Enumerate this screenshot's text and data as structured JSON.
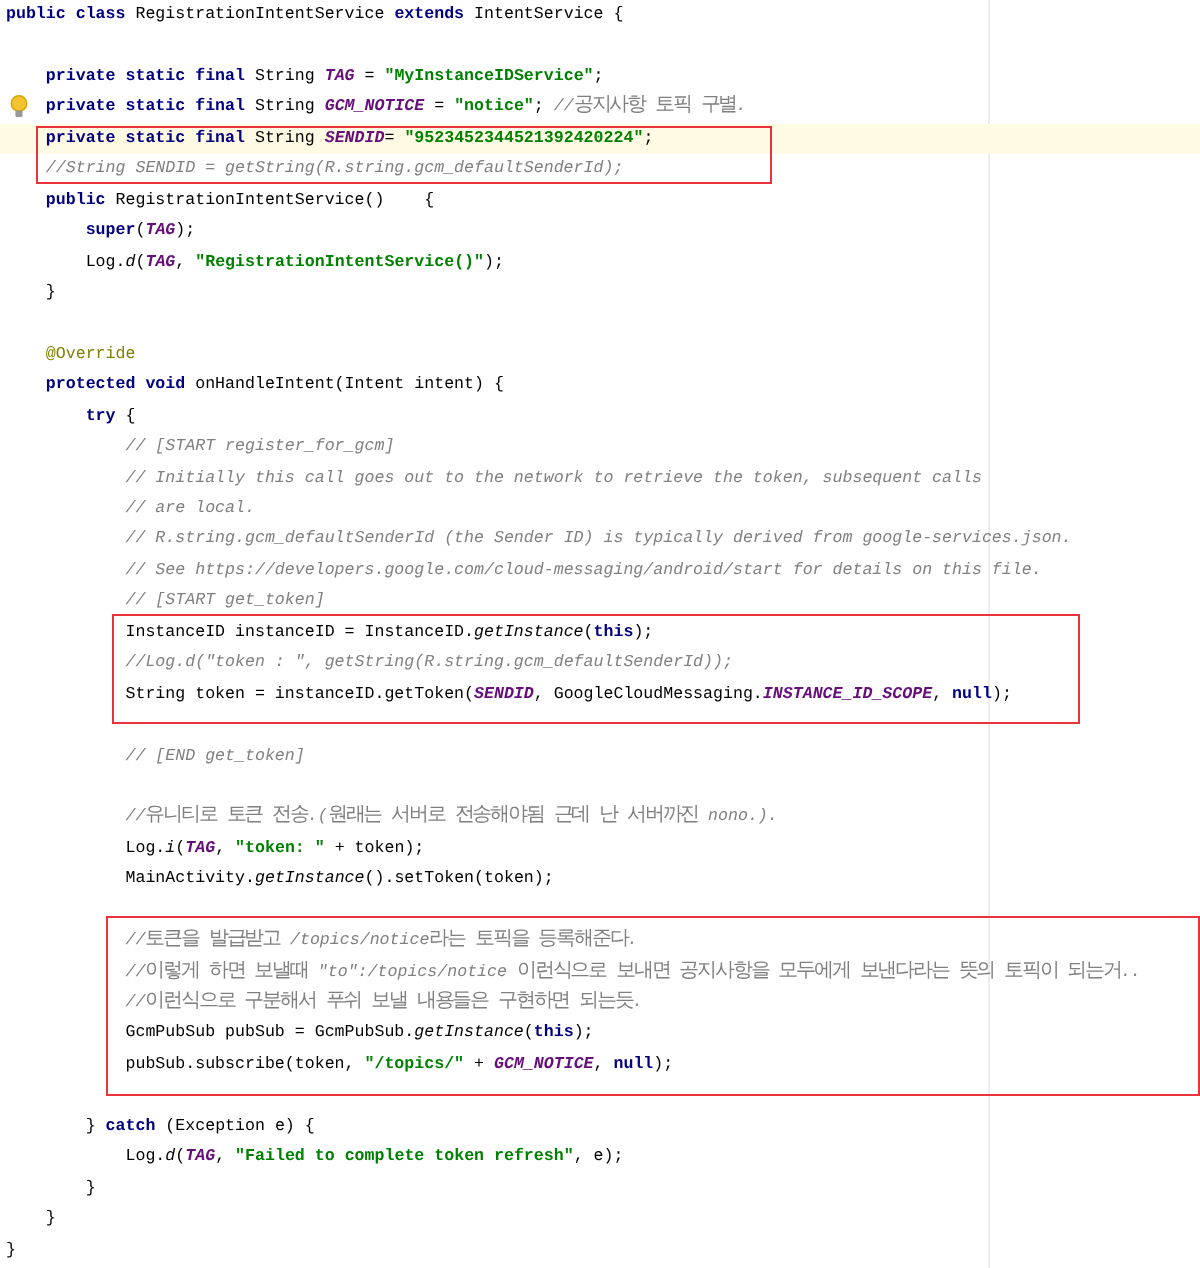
{
  "editor": {
    "blocks": [
      {
        "kind": "plain",
        "lines": [
          {
            "current": false,
            "hint": false,
            "tokens": [
              {
                "kind": "kw",
                "text": "public class"
              },
              {
                "kind": "plain",
                "text": " RegistrationIntentService "
              },
              {
                "kind": "kw",
                "text": "extends"
              },
              {
                "kind": "plain",
                "text": " IntentService {"
              }
            ]
          },
          {
            "kind": "blank"
          },
          {
            "current": false,
            "hint": false,
            "tokens": [
              {
                "kind": "kw",
                "text": "    private static final"
              },
              {
                "kind": "plain",
                "text": " String "
              },
              {
                "kind": "field",
                "text": "TAG"
              },
              {
                "kind": "plain",
                "text": " = "
              },
              {
                "kind": "str",
                "text": "\"MyInstanceIDService\""
              },
              {
                "kind": "plain",
                "text": ";"
              }
            ]
          },
          {
            "current": false,
            "hint": true,
            "tokens": [
              {
                "kind": "kw",
                "text": "    private static final"
              },
              {
                "kind": "plain",
                "text": " String "
              },
              {
                "kind": "field",
                "text": "GCM_NOTICE"
              },
              {
                "kind": "plain",
                "text": " = "
              },
              {
                "kind": "str",
                "text": "\"notice\""
              },
              {
                "kind": "plain",
                "text": "; "
              },
              {
                "kind": "comment",
                "text": "//공지사항 토픽 구별."
              }
            ]
          }
        ]
      },
      {
        "kind": "boxed",
        "lines": [
          {
            "current": true,
            "hint": false,
            "tokens": [
              {
                "kind": "kw",
                "text": "    private static final"
              },
              {
                "kind": "plain",
                "text": " String "
              },
              {
                "kind": "field",
                "text": "SENDID"
              },
              {
                "kind": "plain",
                "text": "= "
              },
              {
                "kind": "str",
                "text": "\"9523452344521392420224\""
              },
              {
                "kind": "plain",
                "text": ";"
              }
            ]
          },
          {
            "current": false,
            "hint": false,
            "tokens": [
              {
                "kind": "comment",
                "text": "    //String SENDID = getString(R.string.gcm_defaultSenderId);"
              }
            ]
          }
        ]
      },
      {
        "kind": "plain",
        "lines": [
          {
            "current": false,
            "hint": false,
            "tokens": [
              {
                "kind": "kw",
                "text": "    public"
              },
              {
                "kind": "plain",
                "text": " RegistrationIntentService()    {"
              }
            ]
          },
          {
            "current": false,
            "hint": false,
            "tokens": [
              {
                "kind": "kw",
                "text": "        super"
              },
              {
                "kind": "plain",
                "text": "("
              },
              {
                "kind": "field",
                "text": "TAG"
              },
              {
                "kind": "plain",
                "text": ");"
              }
            ]
          },
          {
            "current": false,
            "hint": false,
            "tokens": [
              {
                "kind": "plain",
                "text": "        Log."
              },
              {
                "kind": "italic",
                "text": "d"
              },
              {
                "kind": "plain",
                "text": "("
              },
              {
                "kind": "field",
                "text": "TAG"
              },
              {
                "kind": "plain",
                "text": ", "
              },
              {
                "kind": "str",
                "text": "\"RegistrationIntentService()\""
              },
              {
                "kind": "plain",
                "text": ");"
              }
            ]
          },
          {
            "current": false,
            "hint": false,
            "tokens": [
              {
                "kind": "plain",
                "text": "    }"
              }
            ]
          },
          {
            "kind": "blank"
          },
          {
            "current": false,
            "hint": false,
            "tokens": [
              {
                "kind": "annotation",
                "text": "    @Override"
              }
            ]
          },
          {
            "current": false,
            "hint": false,
            "tokens": [
              {
                "kind": "kw",
                "text": "    protected void"
              },
              {
                "kind": "plain",
                "text": " onHandleIntent(Intent intent) {"
              }
            ]
          },
          {
            "current": false,
            "hint": false,
            "tokens": [
              {
                "kind": "kw",
                "text": "        try"
              },
              {
                "kind": "plain",
                "text": " {"
              }
            ]
          },
          {
            "current": false,
            "hint": false,
            "tokens": [
              {
                "kind": "comment",
                "text": "            // [START register_for_gcm]"
              }
            ]
          },
          {
            "current": false,
            "hint": false,
            "tokens": [
              {
                "kind": "comment",
                "text": "            // Initially this call goes out to the network to retrieve the token, subsequent calls"
              }
            ]
          },
          {
            "current": false,
            "hint": false,
            "tokens": [
              {
                "kind": "comment",
                "text": "            // are local."
              }
            ]
          },
          {
            "current": false,
            "hint": false,
            "tokens": [
              {
                "kind": "comment",
                "text": "            // R.string.gcm_defaultSenderId (the Sender ID) is typically derived from google-services.json."
              }
            ]
          },
          {
            "current": false,
            "hint": false,
            "tokens": [
              {
                "kind": "comment",
                "text": "            // See https://developers.google.com/cloud-messaging/android/start for details on this file."
              }
            ]
          },
          {
            "current": false,
            "hint": false,
            "tokens": [
              {
                "kind": "comment",
                "text": "            // [START get_token]"
              }
            ]
          }
        ]
      },
      {
        "kind": "boxed",
        "lines": [
          {
            "current": false,
            "hint": false,
            "tokens": [
              {
                "kind": "plain",
                "text": "            InstanceID instanceID = InstanceID."
              },
              {
                "kind": "italic",
                "text": "getInstance"
              },
              {
                "kind": "plain",
                "text": "("
              },
              {
                "kind": "kw",
                "text": "this"
              },
              {
                "kind": "plain",
                "text": ");"
              }
            ]
          },
          {
            "current": false,
            "hint": false,
            "tokens": [
              {
                "kind": "comment",
                "text": "            //Log.d(\"token : \", getString(R.string.gcm_defaultSenderId));"
              }
            ]
          },
          {
            "current": false,
            "hint": false,
            "tokens": [
              {
                "kind": "plain",
                "text": "            String token = instanceID.getToken("
              },
              {
                "kind": "field",
                "text": "SENDID"
              },
              {
                "kind": "plain",
                "text": ", GoogleCloudMessaging."
              },
              {
                "kind": "field",
                "text": "INSTANCE_ID_SCOPE"
              },
              {
                "kind": "plain",
                "text": ", "
              },
              {
                "kind": "kw",
                "text": "null"
              },
              {
                "kind": "plain",
                "text": ");"
              }
            ]
          }
        ]
      },
      {
        "kind": "plain",
        "lines": [
          {
            "kind": "blank"
          },
          {
            "current": false,
            "hint": false,
            "tokens": [
              {
                "kind": "comment",
                "text": "            // [END get_token]"
              }
            ]
          },
          {
            "kind": "blank"
          },
          {
            "current": false,
            "hint": false,
            "tokens": [
              {
                "kind": "comment",
                "text": "            //유니티로 토큰 전송.(원래는 서버로 전송해야됨 근데 난 서버까진 nono.)."
              }
            ]
          },
          {
            "current": false,
            "hint": false,
            "tokens": [
              {
                "kind": "plain",
                "text": "            Log."
              },
              {
                "kind": "italic",
                "text": "i"
              },
              {
                "kind": "plain",
                "text": "("
              },
              {
                "kind": "field",
                "text": "TAG"
              },
              {
                "kind": "plain",
                "text": ", "
              },
              {
                "kind": "str",
                "text": "\"token: \""
              },
              {
                "kind": "plain",
                "text": " + token);"
              }
            ]
          },
          {
            "current": false,
            "hint": false,
            "tokens": [
              {
                "kind": "plain",
                "text": "            MainActivity."
              },
              {
                "kind": "italic",
                "text": "getInstance"
              },
              {
                "kind": "plain",
                "text": "().setToken(token);"
              }
            ]
          },
          {
            "kind": "blank"
          }
        ]
      },
      {
        "kind": "boxed",
        "lines": [
          {
            "current": false,
            "hint": false,
            "tokens": [
              {
                "kind": "comment",
                "text": "            //토큰을 발급받고 /topics/notice라는 토픽을 등록해준다."
              }
            ]
          },
          {
            "current": false,
            "hint": false,
            "tokens": [
              {
                "kind": "comment",
                "text": "            //이렇게 하면 보낼때 \"to\":/topics/notice 이런식으로 보내면 공지사항을 모두에게 보낸다라는 뜻의 토픽이 되는거.."
              }
            ]
          },
          {
            "current": false,
            "hint": false,
            "tokens": [
              {
                "kind": "comment",
                "text": "            //이런식으로 구분해서 푸쉬 보낼 내용들은 구현하면 되는듯."
              }
            ]
          },
          {
            "current": false,
            "hint": false,
            "tokens": [
              {
                "kind": "plain",
                "text": "            GcmPubSub pubSub = GcmPubSub."
              },
              {
                "kind": "italic",
                "text": "getInstance"
              },
              {
                "kind": "plain",
                "text": "("
              },
              {
                "kind": "kw",
                "text": "this"
              },
              {
                "kind": "plain",
                "text": ");"
              }
            ]
          },
          {
            "current": false,
            "hint": false,
            "tokens": [
              {
                "kind": "plain",
                "text": "            pubSub.subscribe(token, "
              },
              {
                "kind": "str",
                "text": "\"/topics/\""
              },
              {
                "kind": "plain",
                "text": " + "
              },
              {
                "kind": "field",
                "text": "GCM_NOTICE"
              },
              {
                "kind": "plain",
                "text": ", "
              },
              {
                "kind": "kw",
                "text": "null"
              },
              {
                "kind": "plain",
                "text": ");"
              }
            ]
          }
        ]
      },
      {
        "kind": "plain",
        "lines": [
          {
            "kind": "blank"
          },
          {
            "current": false,
            "hint": false,
            "tokens": [
              {
                "kind": "plain",
                "text": "        } "
              },
              {
                "kind": "kw",
                "text": "catch"
              },
              {
                "kind": "plain",
                "text": " (Exception e) {"
              }
            ]
          },
          {
            "current": false,
            "hint": false,
            "tokens": [
              {
                "kind": "plain",
                "text": "            Log."
              },
              {
                "kind": "italic",
                "text": "d"
              },
              {
                "kind": "plain",
                "text": "("
              },
              {
                "kind": "field",
                "text": "TAG"
              },
              {
                "kind": "plain",
                "text": ", "
              },
              {
                "kind": "str",
                "text": "\"Failed to complete token refresh\""
              },
              {
                "kind": "plain",
                "text": ", e);"
              }
            ]
          },
          {
            "current": false,
            "hint": false,
            "tokens": [
              {
                "kind": "plain",
                "text": "        }"
              }
            ]
          },
          {
            "current": false,
            "hint": false,
            "tokens": [
              {
                "kind": "plain",
                "text": "    }"
              }
            ]
          },
          {
            "current": false,
            "hint": false,
            "tokens": [
              {
                "kind": "plain",
                "text": "}"
              }
            ]
          }
        ]
      }
    ]
  }
}
